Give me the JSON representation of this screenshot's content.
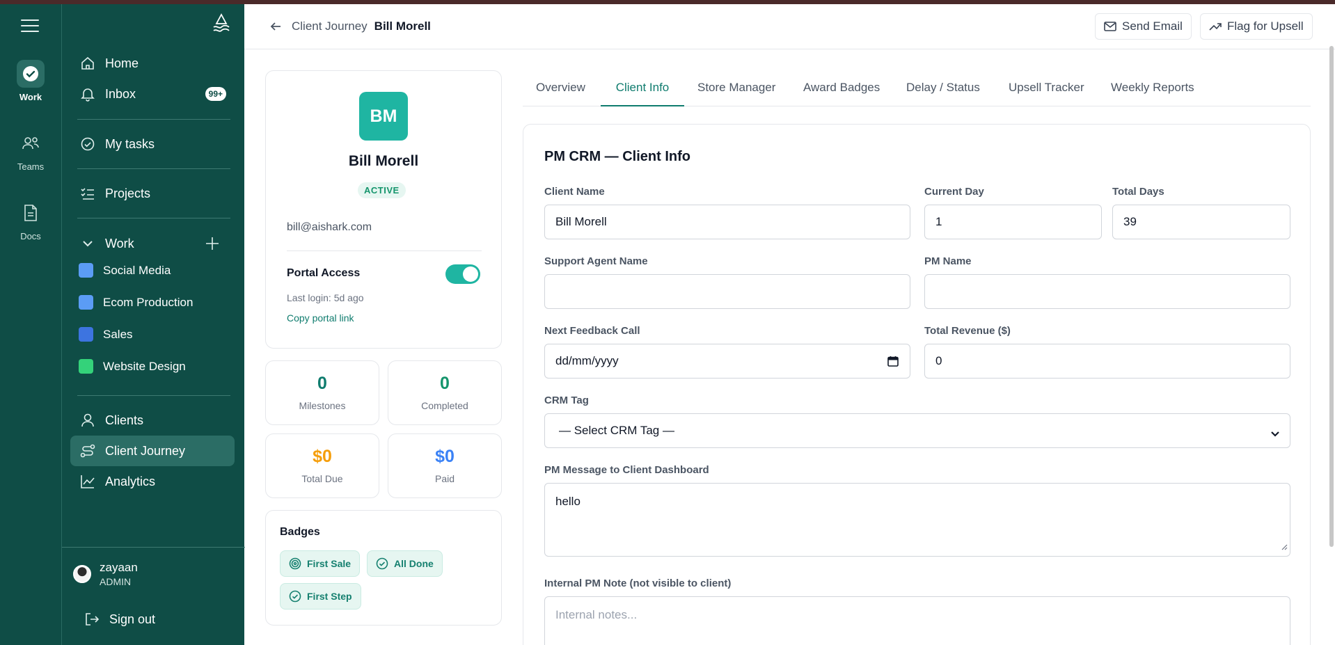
{
  "rail": {
    "items": [
      {
        "label": "Work",
        "icon": "work-check-icon",
        "active": true
      },
      {
        "label": "Teams",
        "icon": "teams-icon",
        "active": false
      },
      {
        "label": "Docs",
        "icon": "docs-icon",
        "active": false
      }
    ]
  },
  "sidebar": {
    "nav_top": [
      {
        "label": "Home",
        "icon": "home-icon"
      },
      {
        "label": "Inbox",
        "icon": "bell-icon",
        "count": "99+"
      }
    ],
    "my_tasks": "My tasks",
    "projects": "Projects",
    "work_section": "Work",
    "workspaces": [
      {
        "label": "Social Media",
        "color": "#5b9cf5"
      },
      {
        "label": "Ecom Production",
        "color": "#5b9cf5"
      },
      {
        "label": "Sales",
        "color": "#3d74e0"
      },
      {
        "label": "Website Design",
        "color": "#34d27a"
      }
    ],
    "nav_bottom": [
      {
        "label": "Clients",
        "icon": "user-icon"
      },
      {
        "label": "Client Journey",
        "icon": "route-icon",
        "active": true
      },
      {
        "label": "Analytics",
        "icon": "chart-line-icon"
      }
    ],
    "user": {
      "name": "zayaan",
      "role": "ADMIN"
    },
    "sign_out": "Sign out"
  },
  "header": {
    "breadcrumb": "Client Journey",
    "title": "Bill Morell",
    "send_email": "Send Email",
    "flag_upsell": "Flag for Upsell"
  },
  "profile": {
    "initials": "BM",
    "name": "Bill Morell",
    "status": "ACTIVE",
    "email": "bill@aishark.com",
    "portal_access_label": "Portal Access",
    "portal_access_on": true,
    "last_login": "Last login: 5d ago",
    "copy_link": "Copy portal link"
  },
  "stats": [
    {
      "value": "0",
      "label": "Milestones",
      "color": "#0f7c6e"
    },
    {
      "value": "0",
      "label": "Completed",
      "color": "#15956c"
    },
    {
      "value": "$0",
      "label": "Total Due",
      "color": "#f59e0b"
    },
    {
      "value": "$0",
      "label": "Paid",
      "color": "#3b82f6"
    }
  ],
  "badges": {
    "title": "Badges",
    "items": [
      {
        "label": "First Sale",
        "icon": "target-icon"
      },
      {
        "label": "All Done",
        "icon": "check-circle-icon"
      },
      {
        "label": "First Step",
        "icon": "check-circle-icon"
      }
    ]
  },
  "tabs": [
    "Overview",
    "Client Info",
    "Store Manager",
    "Award Badges",
    "Delay / Status",
    "Upsell Tracker",
    "Weekly Reports"
  ],
  "active_tab": "Client Info",
  "form": {
    "title": "PM CRM — Client Info",
    "client_name": {
      "label": "Client Name",
      "value": "Bill Morell"
    },
    "current_day": {
      "label": "Current Day",
      "value": "1"
    },
    "total_days": {
      "label": "Total Days",
      "value": "39"
    },
    "support_agent": {
      "label": "Support Agent Name",
      "value": ""
    },
    "pm_name": {
      "label": "PM Name",
      "value": ""
    },
    "next_feedback": {
      "label": "Next Feedback Call",
      "value": "dd/mm/yyyy"
    },
    "total_revenue": {
      "label": "Total Revenue ($)",
      "value": "0"
    },
    "crm_tag": {
      "label": "CRM Tag",
      "value": "— Select CRM Tag —"
    },
    "pm_message": {
      "label": "PM Message to Client Dashboard",
      "value": "hello"
    },
    "internal_note": {
      "label": "Internal PM Note (not visible to client)",
      "placeholder": "Internal notes..."
    }
  },
  "colors": {
    "sidebar": "#0f4d46",
    "accent": "#1fb5a2",
    "active_tab": "#0f7c6e"
  }
}
